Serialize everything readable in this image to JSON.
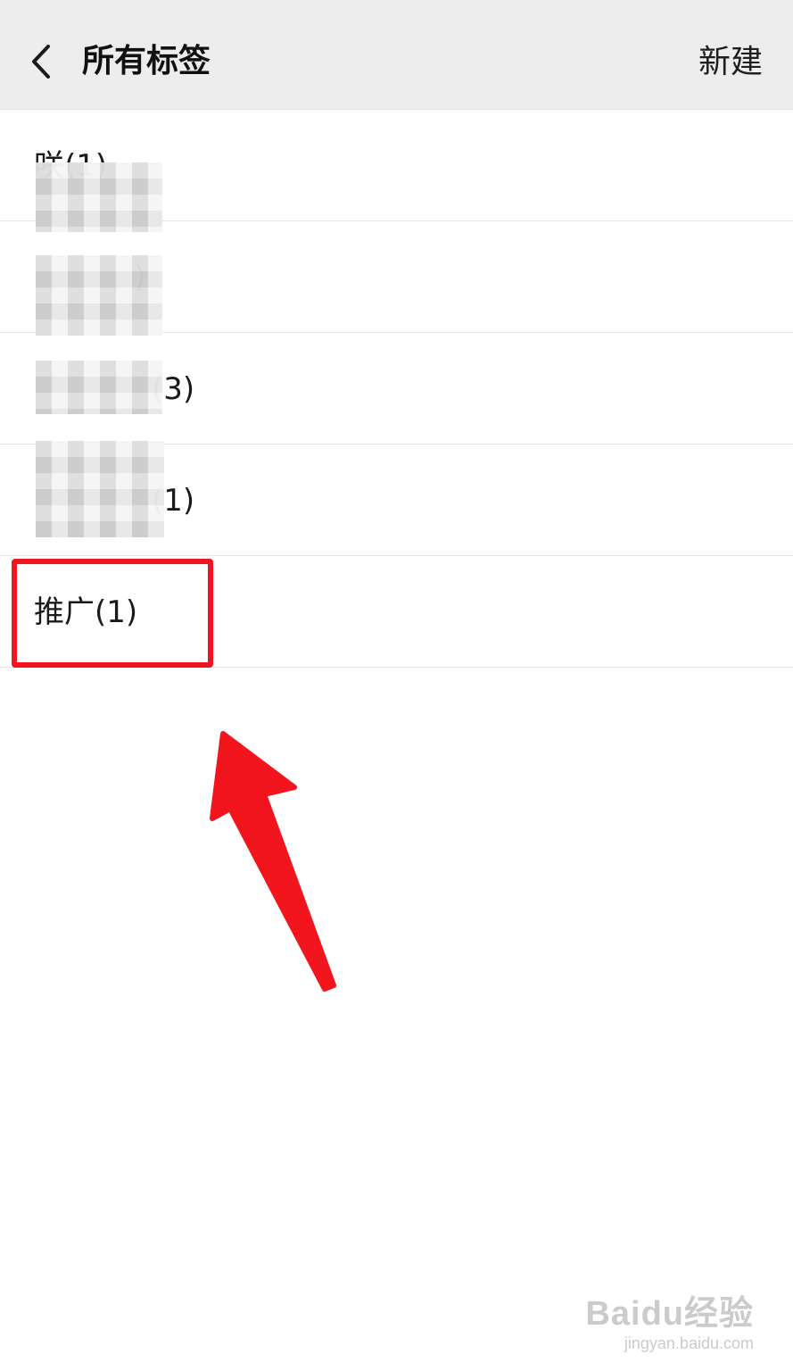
{
  "header": {
    "title": "所有标签",
    "new_label": "新建"
  },
  "tags": [
    {
      "label": "咲(1)",
      "obscured": true
    },
    {
      "label": ")",
      "obscured": true
    },
    {
      "label": "(3)",
      "obscured": true
    },
    {
      "label": "(1)",
      "obscured": true
    },
    {
      "label": "推广(1)",
      "obscured": false
    }
  ],
  "annotation": {
    "highlighted_tag": "推广(1)",
    "accent_color": "#f2151d"
  },
  "watermark": {
    "logo": "Baidu经验",
    "url": "jingyan.baidu.com"
  }
}
